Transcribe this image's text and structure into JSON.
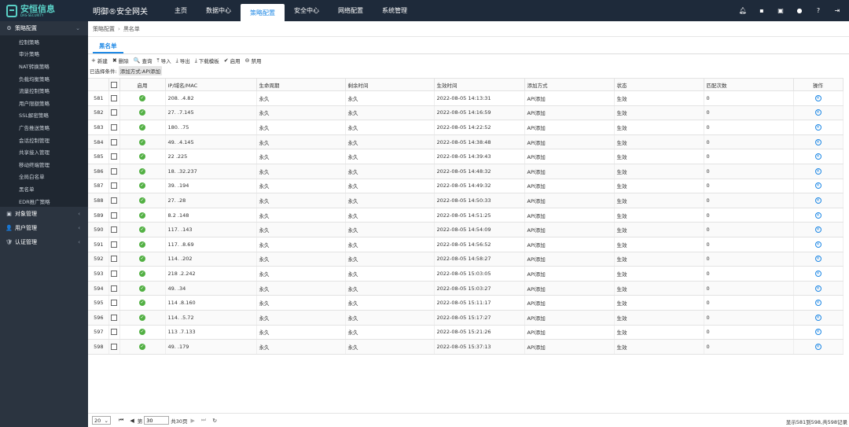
{
  "brand": {
    "cn": "安恒信息",
    "en": "DAS-SECURITY",
    "product": "明御®安全网关"
  },
  "nav": [
    "主页",
    "数据中心",
    "策略配置",
    "安全中心",
    "网络配置",
    "系统管理"
  ],
  "nav_active": 2,
  "sidebar": {
    "groups": [
      {
        "label": "策略配置",
        "icon": "⚙",
        "chev": "⌄",
        "expanded": true,
        "items": [
          "控制策略",
          "审计策略",
          "NAT转换策略",
          "负载均衡策略",
          "流量控制策略",
          "用户限额策略",
          "SSL解密策略",
          "广告推送策略",
          "会话控制管理",
          "共享接入管理",
          "移动终端管理",
          "全局白名单",
          "黑名单",
          "EDR推广策略"
        ]
      },
      {
        "label": "对象管理",
        "icon": "▣",
        "chev": "‹"
      },
      {
        "label": "用户管理",
        "icon": "👤",
        "chev": "‹"
      },
      {
        "label": "认证管理",
        "icon": "🛡",
        "chev": "‹"
      }
    ]
  },
  "breadcrumb": {
    "parent": "策略配置",
    "current": "黑名单"
  },
  "tab": "黑名单",
  "toolbar": [
    {
      "icon": "+",
      "label": "新建",
      "name": "new-button",
      "iname": "plus-icon"
    },
    {
      "icon": "✖",
      "label": "删除",
      "name": "delete-button",
      "iname": "delete-icon"
    },
    {
      "icon": "🔍",
      "label": "查询",
      "name": "query-button",
      "iname": "search-icon"
    },
    {
      "icon": "⤒",
      "label": "导入",
      "name": "import-button",
      "iname": "upload-icon"
    },
    {
      "icon": "⤓",
      "label": "导出",
      "name": "export-button",
      "iname": "download-icon"
    },
    {
      "icon": "⤓",
      "label": "下载模板",
      "name": "download-template-button",
      "iname": "download-icon"
    },
    {
      "icon": "✔",
      "label": "启用",
      "name": "enable-button",
      "iname": "check-circle-icon"
    },
    {
      "icon": "⊖",
      "label": "禁用",
      "name": "disable-button",
      "iname": "minus-circle-icon"
    }
  ],
  "filter": {
    "label": "已选择条件:",
    "chip": "添加方式:API添加"
  },
  "table": {
    "headers": [
      "",
      "",
      "启用",
      "IP/域名/MAC",
      "生命周期",
      "剩余时间",
      "生效时间",
      "添加方式",
      "状态",
      "匹配次数",
      "操作"
    ],
    "rows": [
      {
        "id": "581",
        "ip": "208.  .4.82",
        "life": "永久",
        "remain": "永久",
        "time": "2022-08-05 14:13:31",
        "method": "API添加",
        "status": "生效",
        "count": "0"
      },
      {
        "id": "582",
        "ip": "27.  .7.145",
        "life": "永久",
        "remain": "永久",
        "time": "2022-08-05 14:16:59",
        "method": "API添加",
        "status": "生效",
        "count": "0"
      },
      {
        "id": "583",
        "ip": "180. .75",
        "life": "永久",
        "remain": "永久",
        "time": "2022-08-05 14:22:52",
        "method": "API添加",
        "status": "生效",
        "count": "0"
      },
      {
        "id": "584",
        "ip": "49.  .4.145",
        "life": "永久",
        "remain": "永久",
        "time": "2022-08-05 14:38:48",
        "method": "API添加",
        "status": "生效",
        "count": "0"
      },
      {
        "id": "585",
        "ip": "22  .225",
        "life": "永久",
        "remain": "永久",
        "time": "2022-08-05 14:39:43",
        "method": "API添加",
        "status": "生效",
        "count": "0"
      },
      {
        "id": "586",
        "ip": "18.  .32.237",
        "life": "永久",
        "remain": "永久",
        "time": "2022-08-05 14:48:32",
        "method": "API添加",
        "status": "生效",
        "count": "0"
      },
      {
        "id": "587",
        "ip": "39.  .194",
        "life": "永久",
        "remain": "永久",
        "time": "2022-08-05 14:49:32",
        "method": "API添加",
        "status": "生效",
        "count": "0"
      },
      {
        "id": "588",
        "ip": "27.  .28",
        "life": "永久",
        "remain": "永久",
        "time": "2022-08-05 14:50:33",
        "method": "API添加",
        "status": "生效",
        "count": "0"
      },
      {
        "id": "589",
        "ip": "8.2  .148",
        "life": "永久",
        "remain": "永久",
        "time": "2022-08-05 14:51:25",
        "method": "API添加",
        "status": "生效",
        "count": "0"
      },
      {
        "id": "590",
        "ip": "117.  .143",
        "life": "永久",
        "remain": "永久",
        "time": "2022-08-05 14:54:09",
        "method": "API添加",
        "status": "生效",
        "count": "0"
      },
      {
        "id": "591",
        "ip": "117.  .8.69",
        "life": "永久",
        "remain": "永久",
        "time": "2022-08-05 14:56:52",
        "method": "API添加",
        "status": "生效",
        "count": "0"
      },
      {
        "id": "592",
        "ip": "114.  .202",
        "life": "永久",
        "remain": "永久",
        "time": "2022-08-05 14:58:27",
        "method": "API添加",
        "status": "生效",
        "count": "0"
      },
      {
        "id": "593",
        "ip": "218  .2.242",
        "life": "永久",
        "remain": "永久",
        "time": "2022-08-05 15:03:05",
        "method": "API添加",
        "status": "生效",
        "count": "0"
      },
      {
        "id": "594",
        "ip": "49.  .34",
        "life": "永久",
        "remain": "永久",
        "time": "2022-08-05 15:03:27",
        "method": "API添加",
        "status": "生效",
        "count": "0"
      },
      {
        "id": "595",
        "ip": "114  .8.160",
        "life": "永久",
        "remain": "永久",
        "time": "2022-08-05 15:11:17",
        "method": "API添加",
        "status": "生效",
        "count": "0"
      },
      {
        "id": "596",
        "ip": "114.  .5.72",
        "life": "永久",
        "remain": "永久",
        "time": "2022-08-05 15:17:27",
        "method": "API添加",
        "status": "生效",
        "count": "0"
      },
      {
        "id": "597",
        "ip": "113  .7.133",
        "life": "永久",
        "remain": "永久",
        "time": "2022-08-05 15:21:26",
        "method": "API添加",
        "status": "生效",
        "count": "0"
      },
      {
        "id": "598",
        "ip": "49.  .179",
        "life": "永久",
        "remain": "永久",
        "time": "2022-08-05 15:37:13",
        "method": "API添加",
        "status": "生效",
        "count": "0"
      }
    ]
  },
  "pager": {
    "page_size": "20",
    "page": "30",
    "total_pages": "共30页",
    "info": "显示581到598,共598记录"
  }
}
